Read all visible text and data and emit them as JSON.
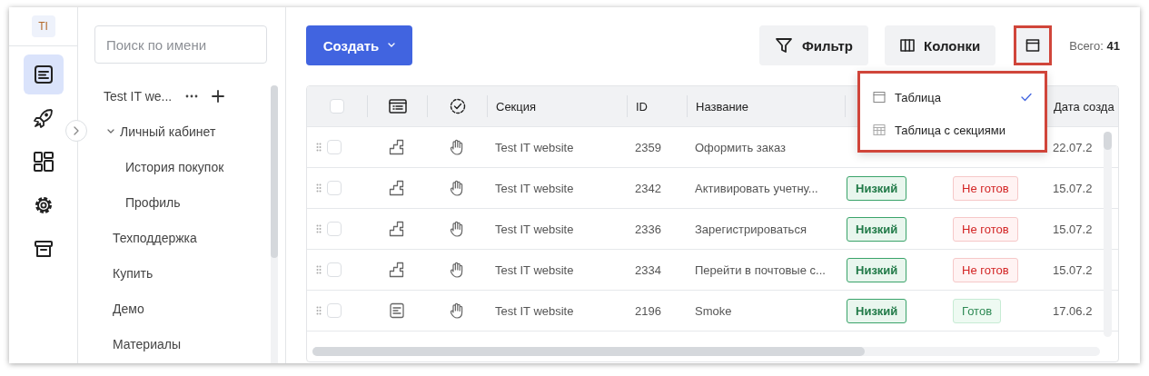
{
  "rail": {
    "avatar": "TI",
    "items": [
      {
        "selected": true
      },
      {
        "selected": false
      },
      {
        "selected": false
      },
      {
        "selected": false
      },
      {
        "selected": false
      }
    ]
  },
  "search": {
    "placeholder": "Поиск по имени"
  },
  "tree": {
    "root": "Test IT we...",
    "children": [
      {
        "label": "Личный кабинет",
        "expanded": true,
        "children": [
          {
            "label": "История покупок"
          },
          {
            "label": "Профиль"
          }
        ]
      },
      {
        "label": "Техподдержка"
      },
      {
        "label": "Купить"
      },
      {
        "label": "Демо"
      },
      {
        "label": "Материалы"
      }
    ]
  },
  "toolbar": {
    "create": "Создать",
    "filter": "Фильтр",
    "columns": "Колонки",
    "total": "Всего: **41**"
  },
  "view_menu": {
    "items": [
      {
        "label": "Таблица",
        "selected": true
      },
      {
        "label": "Таблица с секциями",
        "selected": false
      }
    ]
  },
  "table": {
    "all_checked": false,
    "columns": [
      {
        "label": "Секция"
      },
      {
        "label": "ID"
      },
      {
        "label": "Название"
      },
      {
        "label": "Дата созда"
      }
    ],
    "rows": [
      {
        "checked": false,
        "kind": "steps",
        "section": "Test IT website",
        "id": "2359",
        "name": "Оформить заказ",
        "date": "22.07.2"
      },
      {
        "checked": false,
        "kind": "steps",
        "section": "Test IT website",
        "id": "2342",
        "name": "Активировать учетну...",
        "priority": {
          "label": "Низкий",
          "kind": "low"
        },
        "status": {
          "label": "Не готов",
          "ready": false
        },
        "date": "15.07.2"
      },
      {
        "checked": false,
        "kind": "steps",
        "section": "Test IT website",
        "id": "2336",
        "name": "Зарегистрироваться",
        "priority": {
          "label": "Низкий",
          "kind": "low"
        },
        "status": {
          "label": "Не готов",
          "ready": false
        },
        "date": "15.07.2"
      },
      {
        "checked": false,
        "kind": "steps",
        "section": "Test IT website",
        "id": "2334",
        "name": "Перейти в почтовые с...",
        "priority": {
          "label": "Низкий",
          "kind": "low"
        },
        "status": {
          "label": "Не готов",
          "ready": false
        },
        "date": "15.07.2"
      },
      {
        "checked": false,
        "kind": "case",
        "section": "Test IT website",
        "id": "2196",
        "name": "Smoke",
        "priority": {
          "label": "Низкий",
          "kind": "low"
        },
        "status": {
          "label": "Готов",
          "ready": true
        },
        "date": "17.06.2"
      }
    ]
  }
}
